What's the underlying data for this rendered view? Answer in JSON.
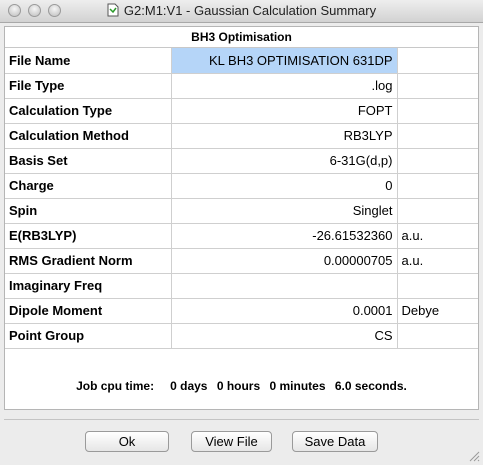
{
  "window": {
    "title": "G2:M1:V1 - Gaussian Calculation Summary"
  },
  "panel": {
    "header": "BH3 Optimisation"
  },
  "rows": [
    {
      "label": "File Name",
      "value": "KL BH3 OPTIMISATION 631DP",
      "unit": ""
    },
    {
      "label": "File Type",
      "value": ".log",
      "unit": ""
    },
    {
      "label": "Calculation Type",
      "value": "FOPT",
      "unit": ""
    },
    {
      "label": "Calculation Method",
      "value": "RB3LYP",
      "unit": ""
    },
    {
      "label": "Basis Set",
      "value": "6-31G(d,p)",
      "unit": ""
    },
    {
      "label": "Charge",
      "value": "0",
      "unit": ""
    },
    {
      "label": "Spin",
      "value": "Singlet",
      "unit": ""
    },
    {
      "label": "E(RB3LYP)",
      "value": "-26.61532360",
      "unit": "a.u."
    },
    {
      "label": "RMS Gradient Norm",
      "value": "0.00000705",
      "unit": "a.u."
    },
    {
      "label": "Imaginary Freq",
      "value": "",
      "unit": ""
    },
    {
      "label": "Dipole Moment",
      "value": "0.0001",
      "unit": "Debye"
    },
    {
      "label": "Point Group",
      "value": "CS",
      "unit": ""
    }
  ],
  "cpu": {
    "label": "Job cpu time:",
    "days": "0 days",
    "hours": "0 hours",
    "minutes": "0 minutes",
    "seconds": "6.0 seconds."
  },
  "buttons": {
    "ok": "Ok",
    "view_file": "View File",
    "save_data": "Save Data"
  }
}
